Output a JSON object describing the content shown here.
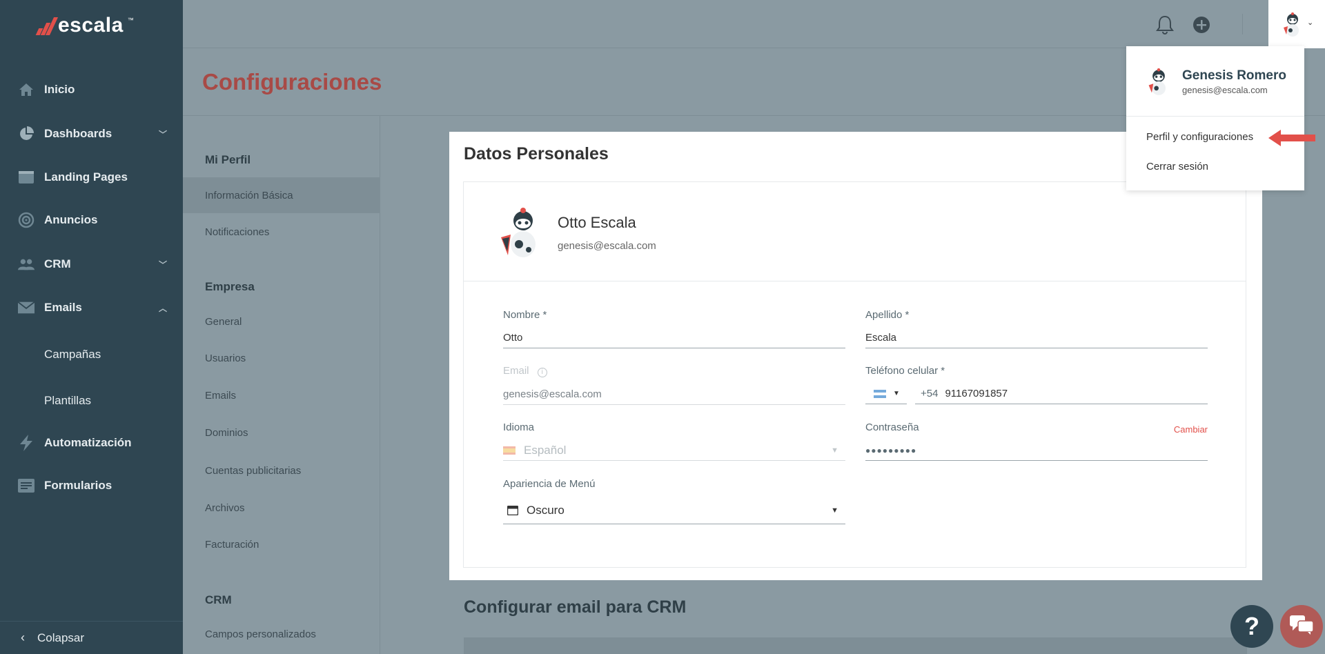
{
  "brand": {
    "name": "escala",
    "tm": "™"
  },
  "sidebar": {
    "items": [
      {
        "label": "Inicio"
      },
      {
        "label": "Dashboards"
      },
      {
        "label": "Landing Pages"
      },
      {
        "label": "Anuncios"
      },
      {
        "label": "CRM"
      },
      {
        "label": "Emails"
      },
      {
        "label": "Automatización"
      },
      {
        "label": "Formularios"
      }
    ],
    "email_subitems": [
      "Campañas",
      "Plantillas"
    ],
    "collapse_label": "Colapsar"
  },
  "header": {
    "title": "Configuraciones"
  },
  "settings_menu": {
    "mi_perfil": "Mi Perfil",
    "mi_perfil_items": [
      "Información Básica",
      "Notificaciones"
    ],
    "empresa": "Empresa",
    "empresa_items": [
      "General",
      "Usuarios",
      "Emails",
      "Dominios",
      "Cuentas publicitarias",
      "Archivos",
      "Facturación"
    ],
    "crm": "CRM",
    "crm_items": [
      "Campos personalizados"
    ]
  },
  "card": {
    "title": "Datos Personales",
    "profile": {
      "name": "Otto Escala",
      "email": "genesis@escala.com"
    },
    "fields": {
      "nombre": {
        "label": "Nombre *",
        "value": "Otto"
      },
      "apellido": {
        "label": "Apellido *",
        "value": "Escala"
      },
      "email": {
        "label": "Email",
        "value": "genesis@escala.com"
      },
      "telefono": {
        "label": "Teléfono celular *",
        "code": "+54",
        "value": "91167091857"
      },
      "idioma": {
        "label": "Idioma",
        "value": "Español"
      },
      "contrasena": {
        "label": "Contraseña",
        "value": "●●●●●●●●●",
        "action": "Cambiar"
      },
      "apariencia": {
        "label": "Apariencia de Menú",
        "value": "Oscuro"
      }
    }
  },
  "section2": {
    "title": "Configurar email para CRM"
  },
  "dropdown": {
    "name": "Genesis Romero",
    "email": "genesis@escala.com",
    "items": [
      "Perfil y configuraciones",
      "Cerrar sesión"
    ]
  },
  "help": {
    "label": "?"
  },
  "colors": {
    "sidebar": "#2f4652",
    "accent": "#e2504a",
    "title": "#a84a46"
  }
}
